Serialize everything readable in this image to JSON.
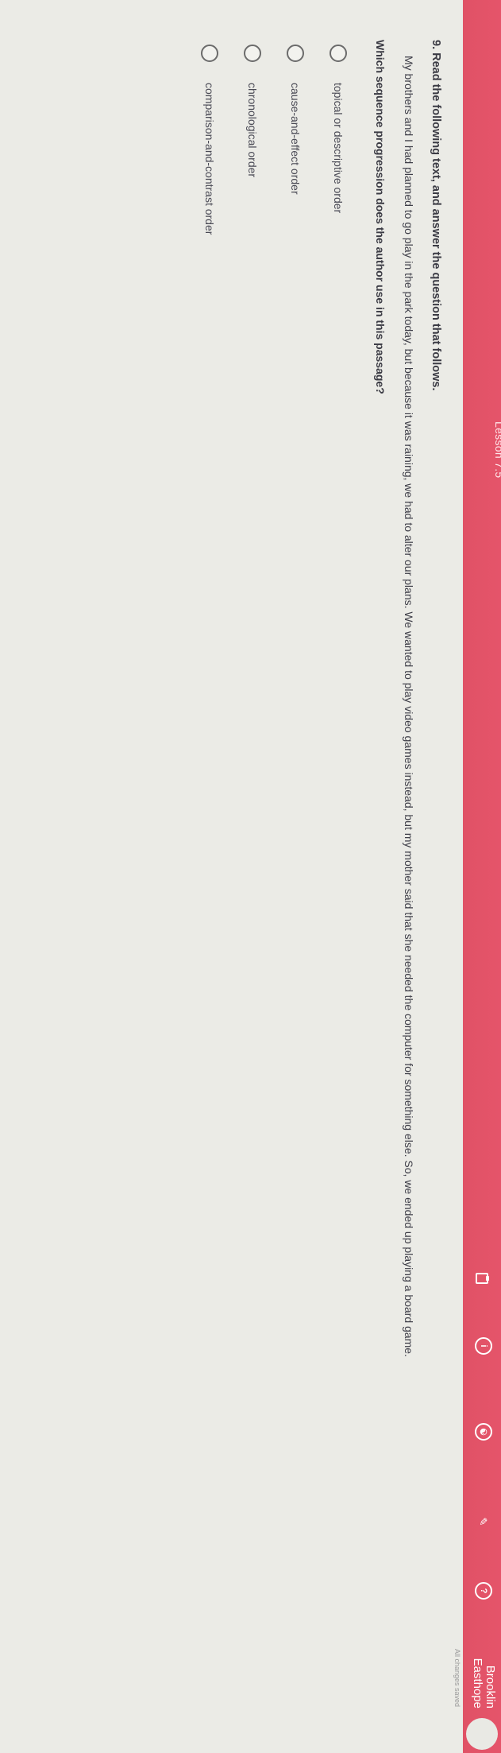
{
  "header": {
    "title": "Lesson 7.5",
    "icons": [
      "clipboard-icon",
      "info-icon",
      "accessibility-icon",
      "pencil-icon",
      "help-icon"
    ],
    "user_name_first": "Brooklin",
    "user_name_last": "Easthope",
    "saved_status": "All changes saved",
    "accent_color": "#e05266"
  },
  "question": {
    "title": "9. Read the following text, and answer the question that follows.",
    "passage": "My brothers and I had planned to go play in the park today, but because it was raining, we had to alter our plans. We wanted to play video games instead, but my mother said that she needed the computer for something else. So, we ended up playing a board game.",
    "prompt": "Which sequence progression does the author use in this passage?",
    "options": [
      {
        "label": "topical or descriptive order"
      },
      {
        "label": "cause-and-effect order"
      },
      {
        "label": "chronological order"
      },
      {
        "label": "comparison-and-contrast order"
      }
    ]
  }
}
